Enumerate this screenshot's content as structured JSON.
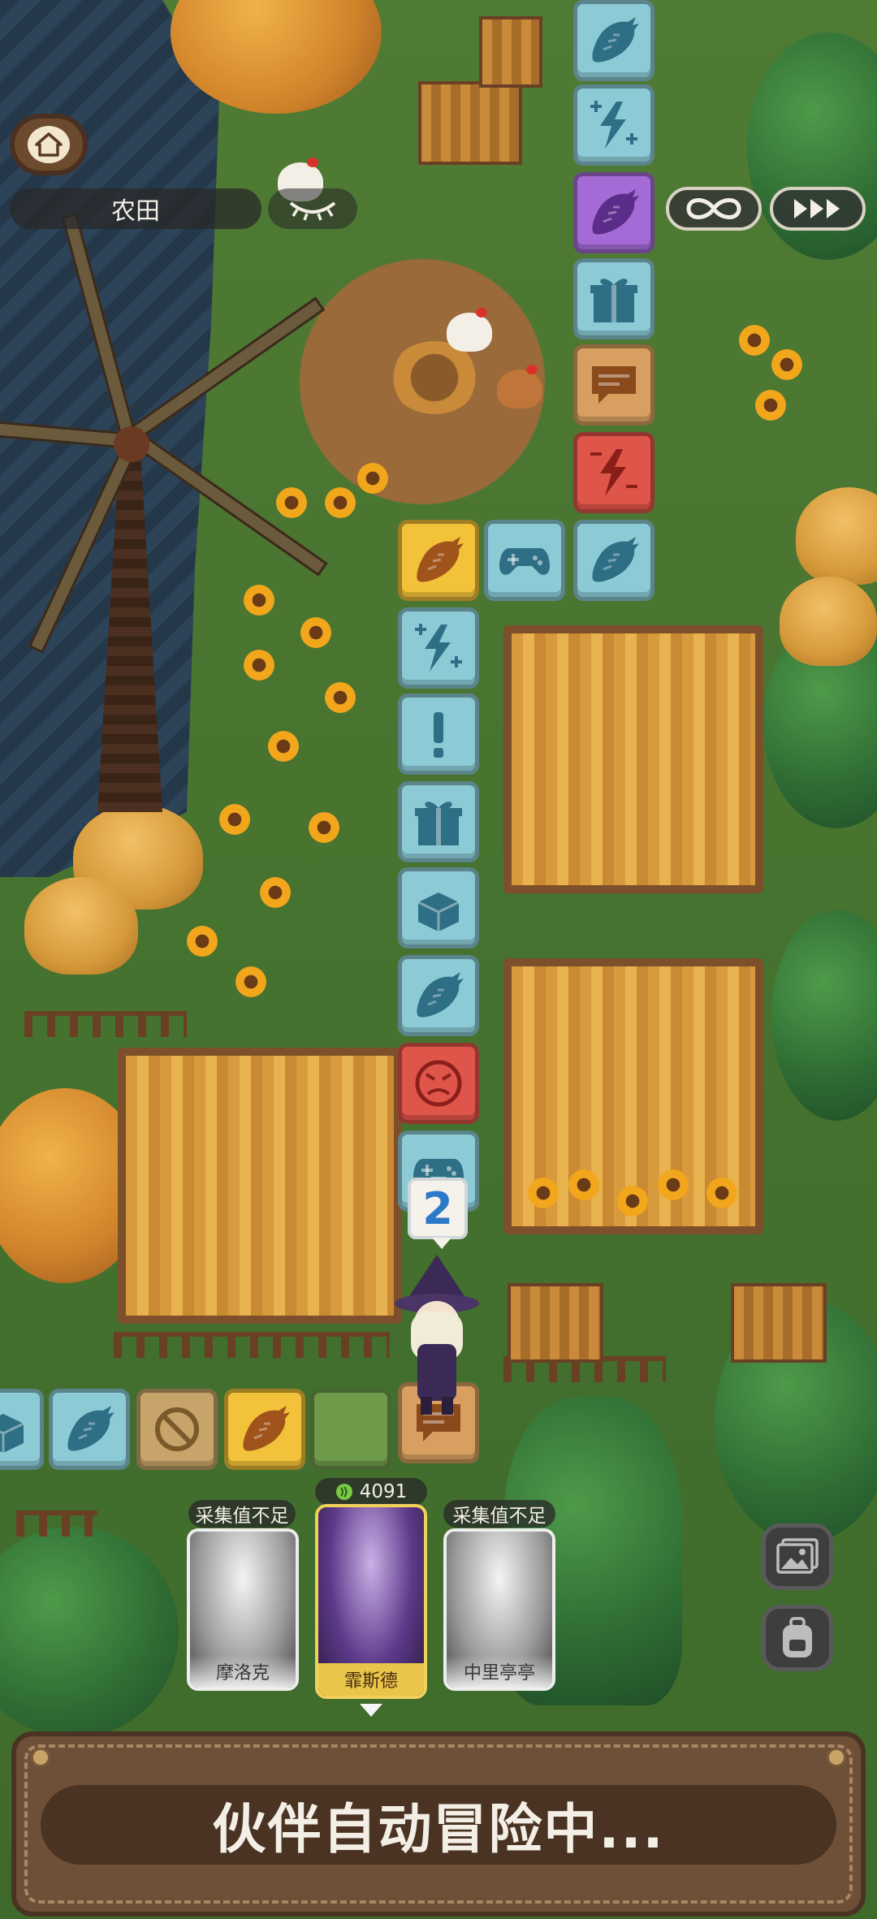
{
  "hud": {
    "location_name": "农田",
    "home_icon": "home-icon",
    "hide_ui_icon": "eye-closed-icon",
    "auto_icon": "infinity-icon",
    "speed_icon": "fast-forward-icon"
  },
  "board": {
    "dice_value": "2",
    "tiles": [
      {
        "type": "carrot",
        "color": "blue"
      },
      {
        "type": "energy-plus",
        "color": "blue"
      },
      {
        "type": "carrot",
        "color": "purple"
      },
      {
        "type": "gift",
        "color": "blue"
      },
      {
        "type": "chat",
        "color": "orange"
      },
      {
        "type": "energy-minus",
        "color": "red"
      },
      {
        "type": "carrot",
        "color": "blue"
      },
      {
        "type": "gamepad",
        "color": "blue"
      },
      {
        "type": "carrot",
        "color": "yellow"
      },
      {
        "type": "energy-plus",
        "color": "blue"
      },
      {
        "type": "exclamation",
        "color": "blue"
      },
      {
        "type": "gift",
        "color": "blue"
      },
      {
        "type": "box",
        "color": "blue"
      },
      {
        "type": "carrot",
        "color": "blue"
      },
      {
        "type": "angry-face",
        "color": "red"
      },
      {
        "type": "gamepad",
        "color": "blue"
      },
      {
        "type": "chat",
        "color": "orange"
      },
      {
        "type": "blank",
        "color": "green"
      },
      {
        "type": "carrot",
        "color": "yellow"
      },
      {
        "type": "blocked",
        "color": "tan"
      },
      {
        "type": "carrot",
        "color": "blue"
      },
      {
        "type": "box",
        "color": "blue"
      }
    ]
  },
  "party": {
    "active_badge_value": "4091",
    "cards": [
      {
        "name": "摩洛克",
        "tag": "采集值不足",
        "state": "disabled"
      },
      {
        "name": "霏斯德",
        "tag": "",
        "state": "active"
      },
      {
        "name": "中里亭亭",
        "tag": "采集值不足",
        "state": "disabled"
      }
    ]
  },
  "side_buttons": {
    "gallery_icon": "gallery-icon",
    "backpack_icon": "backpack-icon"
  },
  "banner": {
    "status_text": "伙伴自动冒险中..."
  },
  "colors": {
    "tile_blue": "#8ccbd6",
    "tile_red": "#e0554a",
    "tile_yellow": "#f2c23a",
    "tile_purple": "#a46bd6",
    "banner_brown": "#6e5038",
    "dice_blue": "#2c78c9"
  }
}
